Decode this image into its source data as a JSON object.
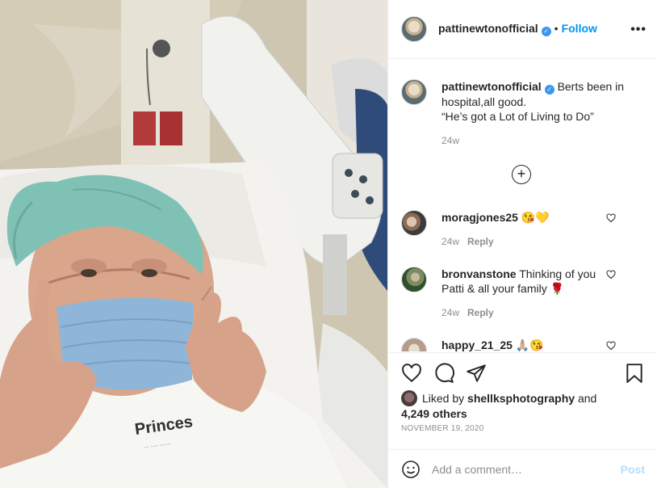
{
  "post": {
    "username": "pattinewtonofficial",
    "follow_label": "Follow",
    "more_label": "•••",
    "caption_text": "Berts been in hospital,all good.",
    "caption_quote": "“He’s got a Lot of Living to Do”",
    "caption_time": "24w",
    "photo_print": "Princes"
  },
  "comments": [
    {
      "username": "moragjones25",
      "text": "😘💛",
      "time": "24w",
      "reply_label": "Reply"
    },
    {
      "username": "bronvanstone",
      "text": "Thinking of you Patti & all your family 🌹",
      "time": "24w",
      "reply_label": "Reply"
    },
    {
      "username": "happy_21_25",
      "text": "🙏🏼😘"
    }
  ],
  "likes": {
    "prefix": "Liked by",
    "user": "shellksphotography",
    "and": "and",
    "others": "4,249 others"
  },
  "date": "NOVEMBER 19, 2020",
  "add_comment": {
    "placeholder": "Add a comment…",
    "post_label": "Post"
  },
  "colors": {
    "link_blue": "#0095f6",
    "verified_blue": "#3897f0",
    "post_disabled": "#b2dffc"
  },
  "icons": [
    "verified-badge-icon",
    "more-options-icon",
    "load-more-comments-icon",
    "heart-icon",
    "comment-icon",
    "share-icon",
    "bookmark-icon",
    "emoji-icon"
  ]
}
